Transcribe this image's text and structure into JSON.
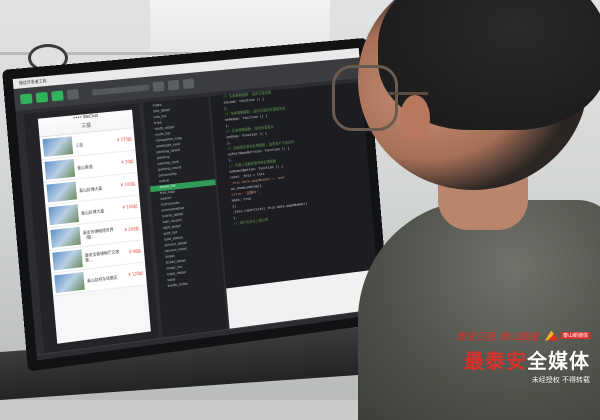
{
  "ide": {
    "menubar_label": "微信开发者工具",
    "phone_title": "三亚",
    "phone_status": "•••• WeChat",
    "listings": [
      {
        "name": "三亚",
        "price": "¥ 775起"
      },
      {
        "name": "泰山索道",
        "price": "¥ 30起"
      },
      {
        "name": "泰山好博大厦",
        "price": "¥ 100起"
      },
      {
        "name": "泰山好博大厦",
        "price": "¥ 100起"
      },
      {
        "name": "泰安市博物馆世界（摄...",
        "price": "¥ 240起"
      },
      {
        "name": "泰安宝泰储物厅文旅景...",
        "price": "¥ 98起"
      },
      {
        "name": "泰山花样车场景区",
        "price": "¥ 120起"
      }
    ],
    "tree_items": [
      "index",
      "info_detail",
      "info_list",
      "tripa",
      "route_detail",
      "route_list",
      "navigation_map",
      "yearbook_rank",
      "parking_detail",
      "parking",
      "parking_rank",
      "parking_result",
      "personality",
      "scenic",
      "scene_list",
      "tree_logs",
      "search",
      "sceneroute",
      "sceneweather",
      "scenic_detail",
      "sign_record",
      "spot_detail",
      "spot_list",
      "spot_status",
      "service_detail",
      "service_hotel",
      "ticket",
      "ticket_detail",
      "ticket_list",
      "hotel_detail",
      "tools",
      "traffic_index"
    ],
    "code_lines": [
      {
        "t": "// 生命周期函数--监听页面加载",
        "c": "comment"
      },
      {
        "t": "onLoad: function () {",
        "c": "key"
      },
      {
        "t": "},",
        "c": "key"
      },
      {
        "t": "// 生命周期函数--监听页面初次渲染完成",
        "c": "comment"
      },
      {
        "t": "onReady: function () {",
        "c": "key"
      },
      {
        "t": "},",
        "c": "key"
      },
      {
        "t": "// 生命周期函数--监听页面显示",
        "c": "comment"
      },
      {
        "t": "onShow: function () {",
        "c": "key"
      },
      {
        "t": "},",
        "c": "key"
      },
      {
        "t": "// 页面相关事件处理函数--监听用户下拉动作",
        "c": "comment"
      },
      {
        "t": "onPullDownRefresh: function () {",
        "c": "key"
      },
      {
        "t": "},",
        "c": "key"
      },
      {
        "t": "// 页面上拉触底事件的处理函数",
        "c": "comment"
      },
      {
        "t": "onReachBottom: function () {",
        "c": "key"
      },
      {
        "t": "  const _this = this",
        "c": "key"
      },
      {
        "t": "  _this.data.pageNumber = 'web'",
        "c": "str"
      },
      {
        "t": "  wx.showLoading({",
        "c": "key"
      },
      {
        "t": "    title: '加载中',",
        "c": "str"
      },
      {
        "t": "    mask: true",
        "c": "key"
      },
      {
        "t": "  })",
        "c": "key"
      },
      {
        "t": "  _this.reportList(_this.data.pageNumber)",
        "c": "key"
      },
      {
        "t": "},",
        "c": "key"
      },
      {
        "t": "// 用户点击右上角分享",
        "c": "comment"
      }
    ]
  },
  "watermark": {
    "calligraphy": "泰安日报 泰山晚报",
    "brand": "泰山新媒体",
    "main_red": "最泰安",
    "main_white": "全媒体",
    "notice": "未经授权 不得转载"
  },
  "colors": {
    "accent_green": "#31b35b",
    "price_red": "#e5493a",
    "watermark_red": "#d8302b"
  }
}
